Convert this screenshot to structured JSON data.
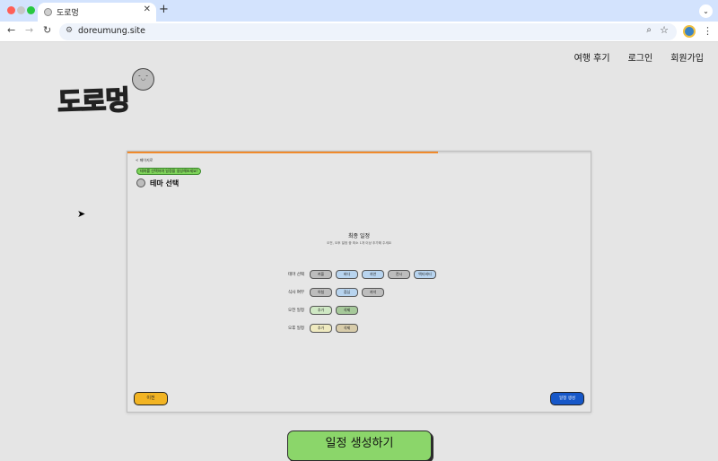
{
  "browser": {
    "tab_title": "도로멍",
    "tab_close": "✕",
    "new_tab": "+",
    "url": "doreumung.site"
  },
  "nav": {
    "items": [
      "여행 후기",
      "로그인",
      "회원가입"
    ]
  },
  "logo": {
    "text": "도로멍"
  },
  "panel": {
    "progress_percent": 67,
    "back_label": "< 페이지로",
    "hint": "테마를 선택하여 일정을 생성해보세요!",
    "step_title": "테마 선택",
    "final_title": "최종 일정",
    "final_subtitle": "오전, 오후 일정 중 최소 1개 이상 추가해 주세요",
    "rows": [
      {
        "label": "테마 선택",
        "chips": [
          {
            "text": "커플",
            "style": "gray"
          },
          {
            "text": "바다",
            "style": "blue"
          },
          {
            "text": "자연",
            "style": "blue"
          },
          {
            "text": "전시",
            "style": "gray"
          },
          {
            "text": "액티비티",
            "style": "blue"
          }
        ]
      },
      {
        "label": "식사 여부",
        "chips": [
          {
            "text": "아침",
            "style": "gray"
          },
          {
            "text": "점심",
            "style": "blue"
          },
          {
            "text": "저녁",
            "style": "gray"
          }
        ]
      },
      {
        "label": "오전 일정",
        "chips": [
          {
            "text": "추가",
            "style": "green-light"
          },
          {
            "text": "삭제",
            "style": "green"
          }
        ]
      },
      {
        "label": "오후 일정",
        "chips": [
          {
            "text": "추가",
            "style": "cream"
          },
          {
            "text": "삭제",
            "style": "tan"
          }
        ]
      }
    ],
    "prev_label": "이전",
    "generate_label": "일정 생성"
  },
  "create_button_label": "일정 생성하기",
  "colors": {
    "accent_orange": "#f08a2c",
    "prev_yellow": "#f2b423",
    "generate_blue": "#1657c8",
    "create_green": "#8bd66a"
  }
}
